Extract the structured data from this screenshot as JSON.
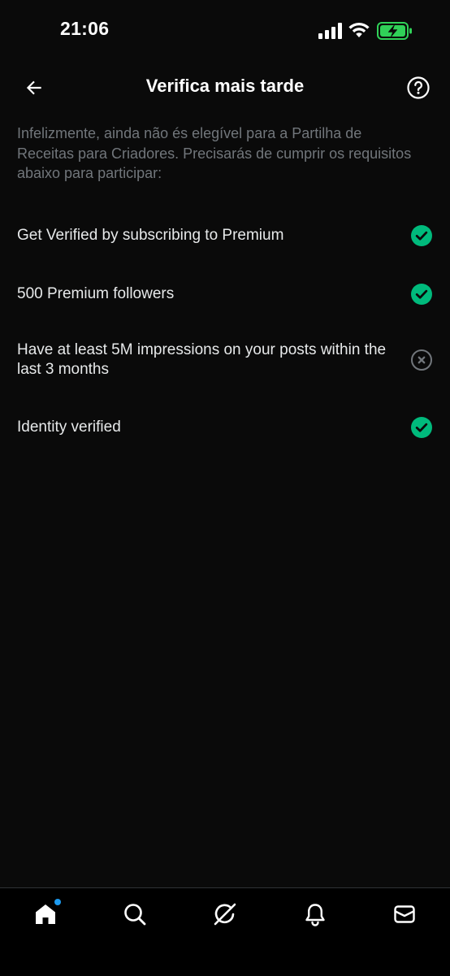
{
  "status_bar": {
    "time": "21:06"
  },
  "header": {
    "title": "Verifica mais tarde"
  },
  "intro": {
    "text": "Infelizmente, ainda não és elegível para a Partilha de Receitas para Criadores. Precisarás de cumprir os requisitos abaixo para participar:"
  },
  "requirements": [
    {
      "label": "Get Verified by subscribing to Premium",
      "met": true
    },
    {
      "label": "500 Premium followers",
      "met": true
    },
    {
      "label": "Have at least 5M impressions on your posts within the last 3 months",
      "met": false
    },
    {
      "label": "Identity verified",
      "met": true
    }
  ],
  "colors": {
    "background": "#0a0a0a",
    "check_green": "#00ba7c",
    "unmet_gray": "#71767b",
    "notification_dot": "#1d9bf0",
    "battery_green": "#30d158"
  },
  "icons": {
    "back": "arrow-left-icon",
    "help": "question-circle-icon",
    "met": "check-circle-icon",
    "unmet": "x-circle-icon",
    "nav": [
      "home-icon",
      "search-icon",
      "grok-icon",
      "bell-icon",
      "mail-icon"
    ]
  }
}
